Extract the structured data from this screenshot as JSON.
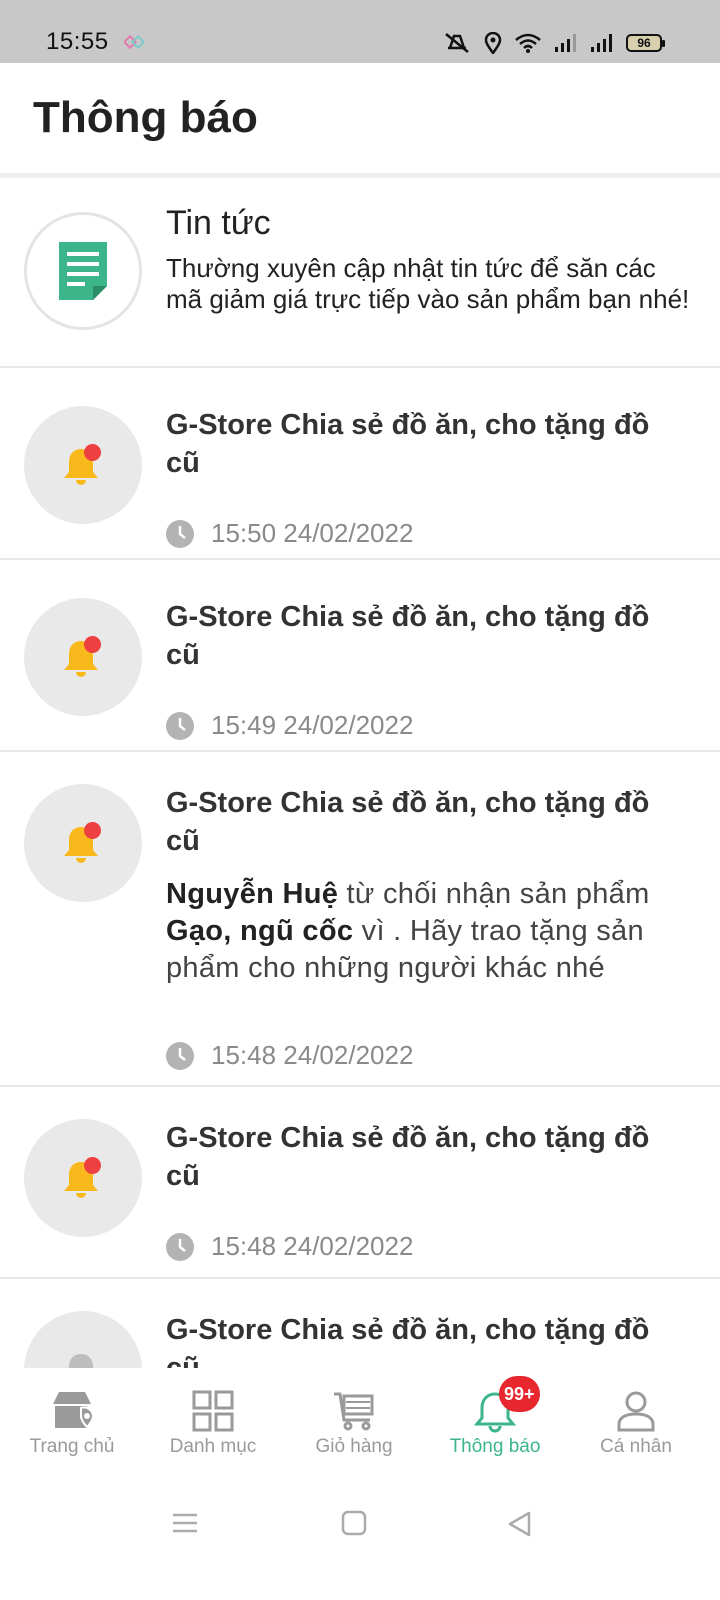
{
  "status": {
    "time": "15:55",
    "battery": "96"
  },
  "header": {
    "title": "Thông báo"
  },
  "news": {
    "title": "Tin tức",
    "description": "Thường xuyên cập nhật tin tức để săn các mã giảm giá trực tiếp vào sản phẩm bạn nhé!"
  },
  "notifications": [
    {
      "title": "G-Store Chia sẻ đồ ăn, cho tặng đồ cũ",
      "time": "15:50 24/02/2022"
    },
    {
      "title": "G-Store Chia sẻ đồ ăn, cho tặng đồ cũ",
      "time": "15:49 24/02/2022"
    },
    {
      "title": "G-Store Chia sẻ đồ ăn, cho tặng đồ cũ",
      "body": {
        "user": "Nguyễn Huệ",
        "text1": " từ chối nhận sản phẩm ",
        "product": "Gạo, ngũ cốc",
        "text2": " vì . Hãy trao tặng sản phẩm cho những người khác nhé"
      },
      "time": "15:48 24/02/2022"
    },
    {
      "title": "G-Store Chia sẻ đồ ăn, cho tặng đồ cũ",
      "time": "15:48 24/02/2022"
    },
    {
      "title": "G-Store Chia sẻ đồ ăn, cho tặng đồ cũ"
    }
  ],
  "tabs": [
    {
      "label": "Trang chủ",
      "icon": "home-store-icon"
    },
    {
      "label": "Danh mục",
      "icon": "grid-icon"
    },
    {
      "label": "Giỏ hàng",
      "icon": "cart-icon"
    },
    {
      "label": "Thông báo",
      "icon": "bell-icon",
      "badge": "99+",
      "active": true
    },
    {
      "label": "Cá nhân",
      "icon": "person-icon"
    }
  ],
  "colors": {
    "accent": "#3bb589",
    "badge": "#e8262e",
    "unread_dot": "#ee4040",
    "bell": "#f9b81c"
  }
}
